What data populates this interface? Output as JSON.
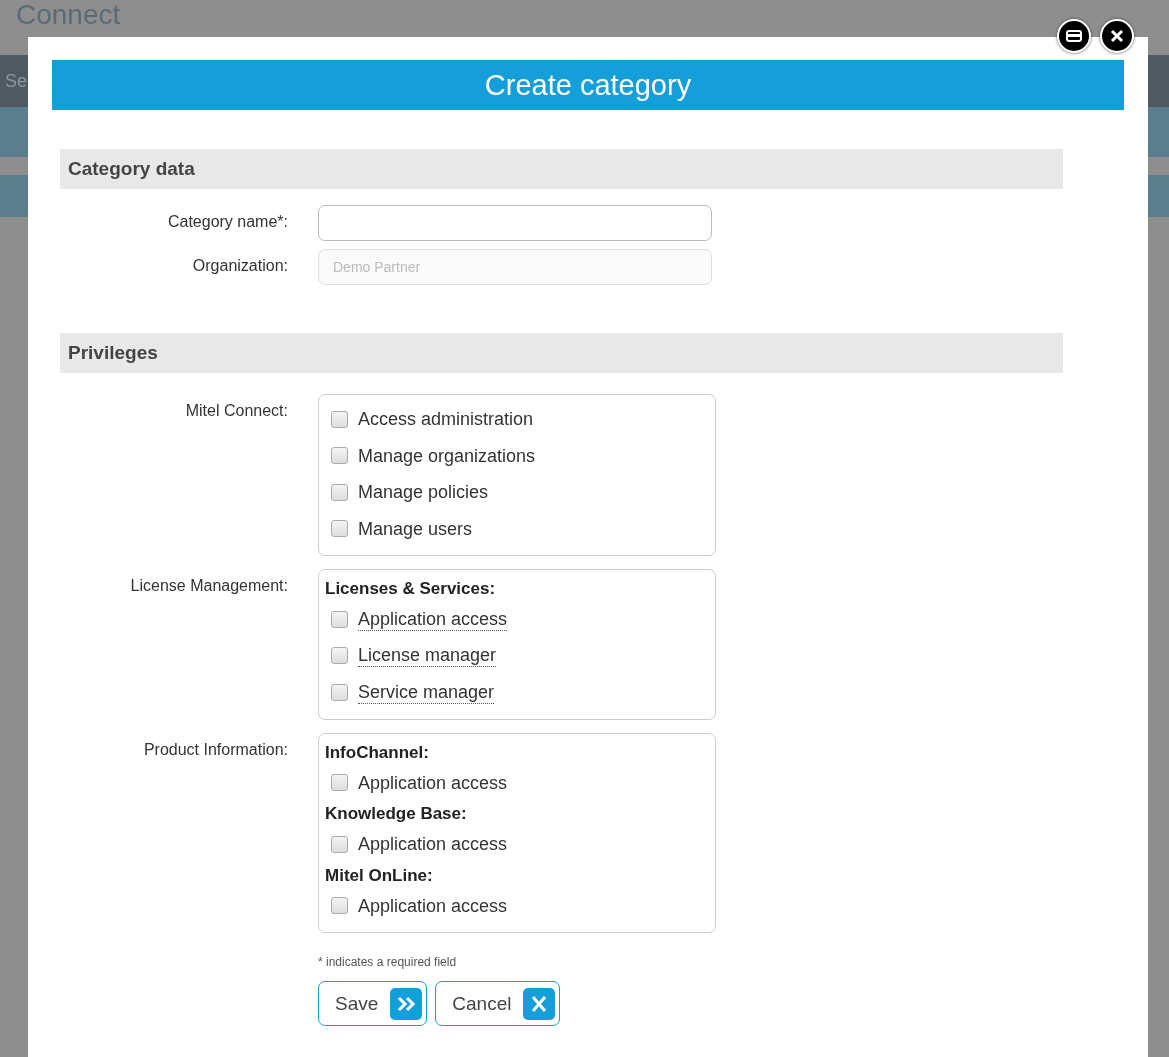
{
  "background": {
    "title": "Connect",
    "nav_text": "Se"
  },
  "dialog": {
    "title": "Create category",
    "sections": [
      {
        "heading": "Category data",
        "kind": "fields",
        "fields": [
          {
            "label": "Category name*:",
            "disabled": false
          },
          {
            "label": "Organization:",
            "value": "Demo Partner",
            "disabled": true
          }
        ]
      },
      {
        "heading": "Privileges",
        "kind": "privileges",
        "groups": [
          {
            "label": "Mitel Connect:",
            "blocks": [
              {
                "options": [
                  {
                    "label": "Access administration",
                    "checked": false,
                    "has_hint": false
                  },
                  {
                    "label": "Manage organizations",
                    "checked": false,
                    "has_hint": false
                  },
                  {
                    "label": "Manage policies",
                    "checked": false,
                    "has_hint": false
                  },
                  {
                    "label": "Manage users",
                    "checked": false,
                    "has_hint": false
                  }
                ]
              }
            ]
          },
          {
            "label": "License Management:",
            "blocks": [
              {
                "heading": "Licenses & Services:",
                "options": [
                  {
                    "label": "Application access",
                    "checked": false,
                    "has_hint": true
                  },
                  {
                    "label": "License manager",
                    "checked": false,
                    "has_hint": true
                  },
                  {
                    "label": "Service manager",
                    "checked": false,
                    "has_hint": true
                  }
                ]
              }
            ]
          },
          {
            "label": "Product Information:",
            "blocks": [
              {
                "heading": "InfoChannel:",
                "options": [
                  {
                    "label": "Application access",
                    "checked": false,
                    "has_hint": false
                  }
                ]
              },
              {
                "heading": "Knowledge Base:",
                "options": [
                  {
                    "label": "Application access",
                    "checked": false,
                    "has_hint": false
                  }
                ]
              },
              {
                "heading": "Mitel OnLine:",
                "options": [
                  {
                    "label": "Application access",
                    "checked": false,
                    "has_hint": false
                  }
                ]
              }
            ]
          }
        ]
      }
    ],
    "note": "* indicates a required field",
    "buttons": [
      {
        "label": "Save",
        "kind": "save"
      },
      {
        "label": "Cancel",
        "kind": "cancel"
      }
    ]
  }
}
